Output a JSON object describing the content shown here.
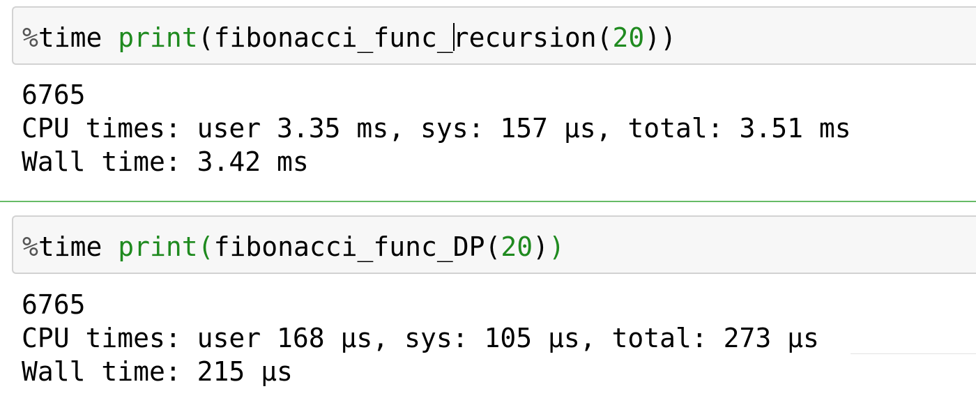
{
  "cells": [
    {
      "input": {
        "magic": "%time",
        "magic_pct": "%",
        "magic_word": "time",
        "builtin": "print",
        "open_paren": "(",
        "func_before_cursor": "fibonacci_func_",
        "func_after_cursor": "recursion",
        "arg_open": "(",
        "arg": "20",
        "close_inner": ")",
        "close_outer": ")"
      },
      "output": {
        "result": "6765",
        "cpu_times": "CPU times: user 3.35 ms, sys: 157 µs, total: 3.51 ms",
        "wall_time": "Wall time: 3.42 ms"
      }
    },
    {
      "input": {
        "magic_pct": "%",
        "magic_word": "time",
        "builtin": "print",
        "open_paren": "(",
        "func": "fibonacci_func_DP",
        "arg_open": "(",
        "arg": "20",
        "close_inner": ")",
        "close_outer": ")"
      },
      "output": {
        "result": "6765",
        "cpu_times": "CPU times: user 168 µs, sys: 105 µs, total: 273 µs",
        "wall_time": "Wall time: 215 µs"
      }
    }
  ],
  "colors": {
    "keyword_green": "#1f8a1f",
    "input_background": "#f7f7f7",
    "input_border": "#d2d2d2",
    "cell_divider": "#66bb66"
  }
}
